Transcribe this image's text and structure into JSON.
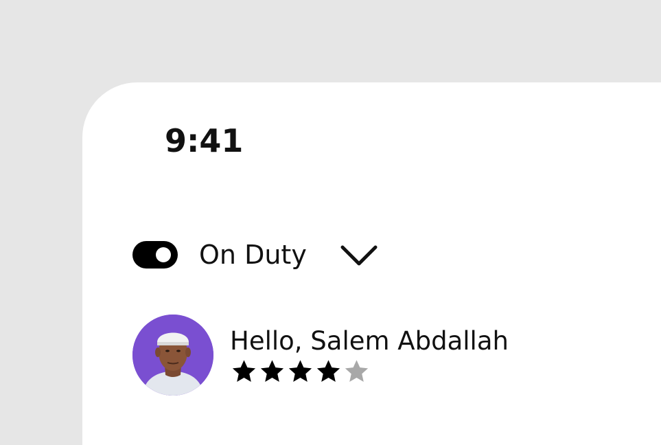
{
  "status_bar": {
    "time": "9:41"
  },
  "duty": {
    "label": "On Duty",
    "toggle_on": true,
    "toggle_color": "#000000",
    "dropdown_icon": "chevron-down-icon"
  },
  "profile": {
    "greeting": "Hello, Salem Abdallah",
    "avatar_background": "#7a4fd1",
    "rating": 4,
    "rating_max": 5,
    "star_filled_color": "#000000",
    "star_empty_color": "#a8a8a8"
  }
}
